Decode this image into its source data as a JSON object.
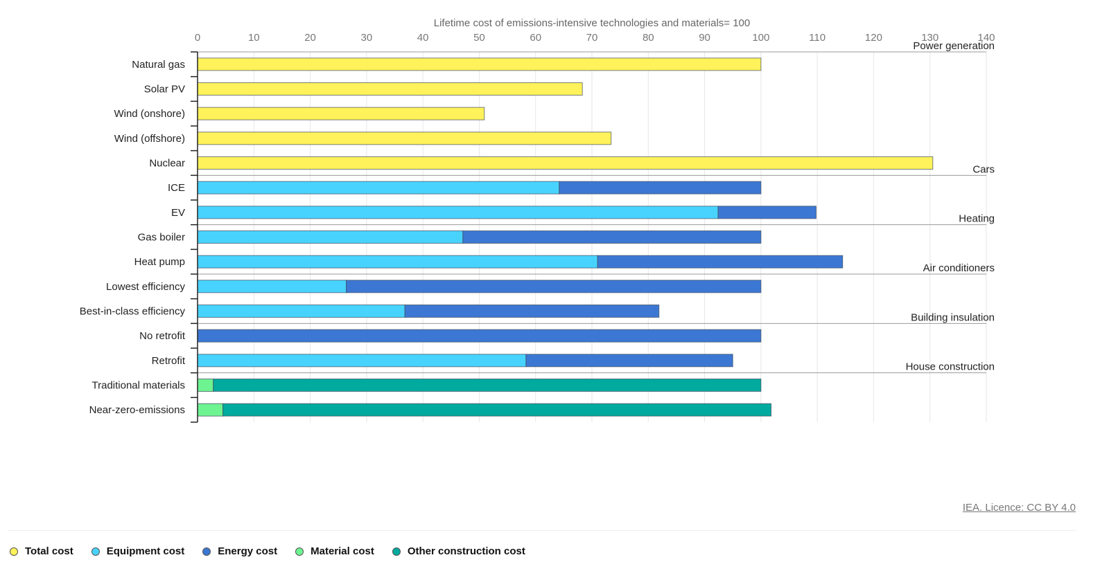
{
  "chart_data": {
    "type": "bar",
    "orientation": "horizontal",
    "stacked": true,
    "title": "",
    "xlabel": "Lifetime cost of emissions-intensive technologies and materials= 100",
    "ylabel": "",
    "xlim": [
      0,
      140
    ],
    "xticks": [
      0,
      10,
      20,
      30,
      40,
      50,
      60,
      70,
      80,
      90,
      100,
      110,
      120,
      130,
      140
    ],
    "grid": true,
    "legend_position": "bottom-left",
    "categories": [
      "Natural gas",
      "Solar PV",
      "Wind (onshore)",
      "Wind (offshore)",
      "Nuclear",
      "ICE",
      "EV",
      "Gas boiler",
      "Heat pump",
      "Lowest efficiency",
      "Best-in-class efficiency",
      "No retrofit",
      "Retrofit",
      "Traditional materials",
      "Near-zero-emissions"
    ],
    "groups": [
      {
        "name": "Power generation",
        "start": 0,
        "end": 4
      },
      {
        "name": "Cars",
        "start": 5,
        "end": 6
      },
      {
        "name": "Heating",
        "start": 7,
        "end": 8
      },
      {
        "name": "Air conditioners",
        "start": 9,
        "end": 10
      },
      {
        "name": "Building insulation",
        "start": 11,
        "end": 12
      },
      {
        "name": "House construction",
        "start": 13,
        "end": 14
      }
    ],
    "series": [
      {
        "name": "Total cost",
        "color": "#fff25a",
        "values": [
          100,
          68.3,
          50.9,
          73.4,
          130.5,
          0,
          0,
          0,
          0,
          0,
          0,
          0,
          0,
          0,
          0
        ]
      },
      {
        "name": "Equipment cost",
        "color": "#48d3fe",
        "values": [
          0,
          0,
          0,
          0,
          0,
          64.2,
          92.4,
          47.1,
          71.0,
          26.4,
          36.8,
          0,
          58.3,
          0,
          0
        ]
      },
      {
        "name": "Energy cost",
        "color": "#3c78d3",
        "values": [
          0,
          0,
          0,
          0,
          0,
          35.8,
          17.4,
          52.9,
          43.5,
          73.6,
          45.1,
          100,
          36.7,
          0,
          0
        ]
      },
      {
        "name": "Material cost",
        "color": "#6ef391",
        "values": [
          0,
          0,
          0,
          0,
          0,
          0,
          0,
          0,
          0,
          0,
          0,
          0,
          0,
          2.8,
          4.5
        ]
      },
      {
        "name": "Other construction cost",
        "color": "#00aa9e",
        "values": [
          0,
          0,
          0,
          0,
          0,
          0,
          0,
          0,
          0,
          0,
          0,
          0,
          0,
          97.2,
          97.3
        ]
      }
    ]
  },
  "credit": "IEA. Licence: CC BY 4.0"
}
